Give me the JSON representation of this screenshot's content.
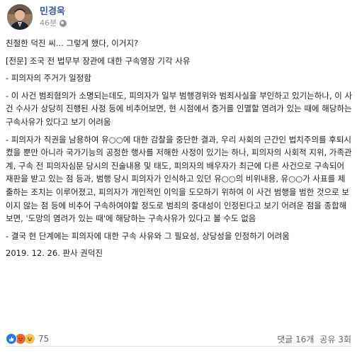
{
  "post": {
    "author": "민경욱",
    "timestamp": "46분",
    "privacy_icon": "globe-icon",
    "paragraphs": [
      "친절한 덕진 씨... 그렇게 했다, 이거지?",
      "[전문] 조국 전 법무부 장관에 대한 구속영장 기각 사유",
      "- 피의자의 주거가 일정함",
      "- 이 사건 범죄혐의가 소명되는데도, 피의자가 일부 범행경위와 범죄사실을 부인하고 있기는하나, 이 사건 수사가 상당히 진행된 사정 등에 비추어보면, 현 시점에서 증거를 인멸할 염려가 있는 때에 해당하는 구속사유가 있다고 보기 어려움",
      "- 피의자가 직권을 남용하여 유○○에 대한 감찰을 중단한 결과, 우리 사회의 근간인 법치주의를 후퇴시켰을 뿐만 아니라 국가기능의 공정한 행사를 저해한 사정이 있기는 하나, 피의자의 사회적 지위, 가족관계, 구속 전 피의자심문 당시의 진술내용 및 태도, 피의자의 배우자가 최근에 다른 사건으로 구속되어 재판을 받고 있는 점 등과, 범행 당시 피의자가 인식하고 있던 유○○의 비위내용, 유○○가 사표를 제출하는 조치는 이루어졌고, 피의자가 개인적인 이익을 도모하기 위하여 이 사건 범행을 범한 것으로 보이지 않는 점 등에 비추어 구속하여야할 정도로 범죄의 중대성이 인정된다고 보기 어려운 점을 종합해보면, '도망의 염려가 있는 때'에 해당하는 구속사유가 있다고 볼 수도 없음",
      "- 결국 현 단계에는 피의자에 대한 구속 사유와 그 필요성, 상당성을 인정하기 어려움",
      "2019. 12. 26. 판사 권덕진"
    ]
  },
  "footer": {
    "reaction_icons": [
      "like-icon",
      "angry-icon",
      "haha-icon"
    ],
    "reaction_count": "75",
    "comments": "댓글 16개",
    "shares": "공유 3회"
  },
  "colors": {
    "author": "#385898",
    "meta": "#90949c",
    "text": "#1c1e21",
    "like": "#2078f4",
    "angry": "#f0642c",
    "haha": "#f7c34a"
  }
}
